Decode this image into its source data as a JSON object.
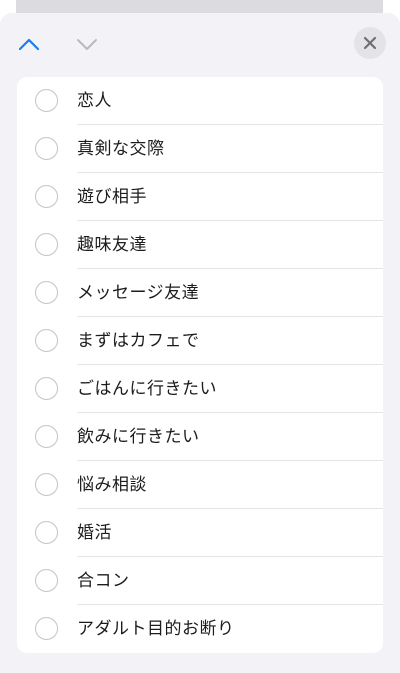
{
  "colors": {
    "accent": "#1a7cf2",
    "chevron_disabled": "#b9b9bf",
    "close_background": "#e3e3e8",
    "close_glyph": "#6e6e73",
    "sheet_background": "#f2f2f7",
    "radio_border": "#c4c4c7"
  },
  "toolbar": {
    "previous_icon": "chevron-up-icon",
    "next_icon": "chevron-down-icon",
    "close_icon": "close-icon"
  },
  "options": [
    {
      "label": "恋人",
      "selected": false
    },
    {
      "label": "真剣な交際",
      "selected": false
    },
    {
      "label": "遊び相手",
      "selected": false
    },
    {
      "label": "趣味友達",
      "selected": false
    },
    {
      "label": "メッセージ友達",
      "selected": false
    },
    {
      "label": "まずはカフェで",
      "selected": false
    },
    {
      "label": "ごはんに行きたい",
      "selected": false
    },
    {
      "label": "飲みに行きたい",
      "selected": false
    },
    {
      "label": "悩み相談",
      "selected": false
    },
    {
      "label": "婚活",
      "selected": false
    },
    {
      "label": "合コン",
      "selected": false
    },
    {
      "label": "アダルト目的お断り",
      "selected": false
    }
  ]
}
